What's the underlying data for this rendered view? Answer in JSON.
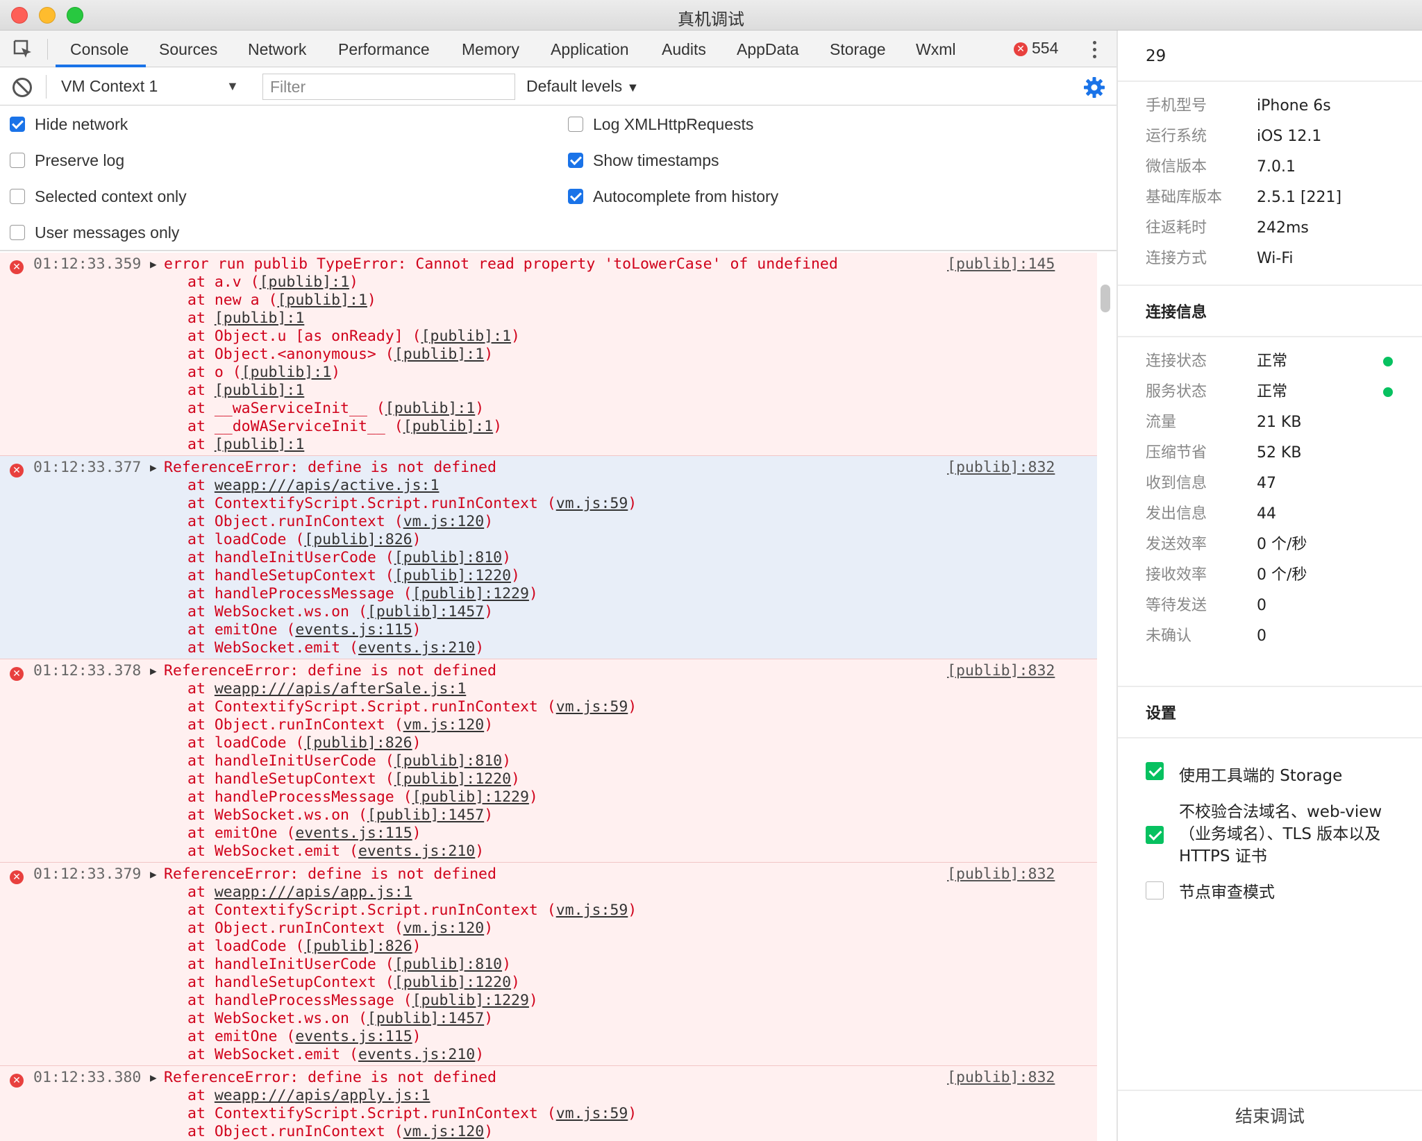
{
  "window": {
    "title": "真机调试"
  },
  "tabs": [
    "Console",
    "Sources",
    "Network",
    "Performance",
    "Memory",
    "Application",
    "Audits",
    "AppData",
    "Storage",
    "Wxml"
  ],
  "error_count": "554",
  "toolbar": {
    "context": "VM Context 1",
    "filter_placeholder": "Filter",
    "levels": "Default levels"
  },
  "settings": {
    "hide_network": {
      "label": "Hide network",
      "checked": true
    },
    "preserve_log": {
      "label": "Preserve log",
      "checked": false
    },
    "selected_context": {
      "label": "Selected context only",
      "checked": false
    },
    "user_messages": {
      "label": "User messages only",
      "checked": false
    },
    "log_xhr": {
      "label": "Log XMLHttpRequests",
      "checked": false
    },
    "show_timestamps": {
      "label": "Show timestamps",
      "checked": true
    },
    "autocomplete": {
      "label": "Autocomplete from history",
      "checked": true
    }
  },
  "messages": [
    {
      "time": "01:12:33.359",
      "text": "error run publib TypeError: Cannot read property 'toLowerCase' of undefined",
      "source": "[publib]:145",
      "highlight": "pink",
      "frames": [
        {
          "fn": "a.v",
          "loc": "[publib]:1",
          "wrap": true
        },
        {
          "fn": "new a",
          "loc": "[publib]:1",
          "wrap": true
        },
        {
          "fn": "",
          "loc": "[publib]:1",
          "wrap": false
        },
        {
          "fn": "Object.u [as onReady]",
          "loc": "[publib]:1",
          "wrap": true
        },
        {
          "fn": "Object.<anonymous>",
          "loc": "[publib]:1",
          "wrap": true
        },
        {
          "fn": "o",
          "loc": "[publib]:1",
          "wrap": true
        },
        {
          "fn": "",
          "loc": "[publib]:1",
          "wrap": false
        },
        {
          "fn": "__waServiceInit__",
          "loc": "[publib]:1",
          "wrap": true
        },
        {
          "fn": "__doWAServiceInit__",
          "loc": "[publib]:1",
          "wrap": true
        },
        {
          "fn": "",
          "loc": "[publib]:1",
          "wrap": false
        }
      ]
    },
    {
      "time": "01:12:33.377",
      "text": "ReferenceError: define is not defined",
      "source": "[publib]:832",
      "highlight": "blue",
      "frames": [
        {
          "fn": "",
          "loc": "weapp:///apis/active.js:1",
          "wrap": false
        },
        {
          "fn": "ContextifyScript.Script.runInContext",
          "loc": "vm.js:59",
          "wrap": true
        },
        {
          "fn": "Object.runInContext",
          "loc": "vm.js:120",
          "wrap": true
        },
        {
          "fn": "loadCode",
          "loc": "[publib]:826",
          "wrap": true
        },
        {
          "fn": "handleInitUserCode",
          "loc": "[publib]:810",
          "wrap": true
        },
        {
          "fn": "handleSetupContext",
          "loc": "[publib]:1220",
          "wrap": true
        },
        {
          "fn": "handleProcessMessage",
          "loc": "[publib]:1229",
          "wrap": true
        },
        {
          "fn": "WebSocket.ws.on",
          "loc": "[publib]:1457",
          "wrap": true
        },
        {
          "fn": "emitOne",
          "loc": "events.js:115",
          "wrap": true
        },
        {
          "fn": "WebSocket.emit",
          "loc": "events.js:210",
          "wrap": true
        }
      ]
    },
    {
      "time": "01:12:33.378",
      "text": "ReferenceError: define is not defined",
      "source": "[publib]:832",
      "highlight": "pink",
      "frames": [
        {
          "fn": "",
          "loc": "weapp:///apis/afterSale.js:1",
          "wrap": false
        },
        {
          "fn": "ContextifyScript.Script.runInContext",
          "loc": "vm.js:59",
          "wrap": true
        },
        {
          "fn": "Object.runInContext",
          "loc": "vm.js:120",
          "wrap": true
        },
        {
          "fn": "loadCode",
          "loc": "[publib]:826",
          "wrap": true
        },
        {
          "fn": "handleInitUserCode",
          "loc": "[publib]:810",
          "wrap": true
        },
        {
          "fn": "handleSetupContext",
          "loc": "[publib]:1220",
          "wrap": true
        },
        {
          "fn": "handleProcessMessage",
          "loc": "[publib]:1229",
          "wrap": true
        },
        {
          "fn": "WebSocket.ws.on",
          "loc": "[publib]:1457",
          "wrap": true
        },
        {
          "fn": "emitOne",
          "loc": "events.js:115",
          "wrap": true
        },
        {
          "fn": "WebSocket.emit",
          "loc": "events.js:210",
          "wrap": true
        }
      ]
    },
    {
      "time": "01:12:33.379",
      "text": "ReferenceError: define is not defined",
      "source": "[publib]:832",
      "highlight": "pink",
      "frames": [
        {
          "fn": "",
          "loc": "weapp:///apis/app.js:1",
          "wrap": false
        },
        {
          "fn": "ContextifyScript.Script.runInContext",
          "loc": "vm.js:59",
          "wrap": true
        },
        {
          "fn": "Object.runInContext",
          "loc": "vm.js:120",
          "wrap": true
        },
        {
          "fn": "loadCode",
          "loc": "[publib]:826",
          "wrap": true
        },
        {
          "fn": "handleInitUserCode",
          "loc": "[publib]:810",
          "wrap": true
        },
        {
          "fn": "handleSetupContext",
          "loc": "[publib]:1220",
          "wrap": true
        },
        {
          "fn": "handleProcessMessage",
          "loc": "[publib]:1229",
          "wrap": true
        },
        {
          "fn": "WebSocket.ws.on",
          "loc": "[publib]:1457",
          "wrap": true
        },
        {
          "fn": "emitOne",
          "loc": "events.js:115",
          "wrap": true
        },
        {
          "fn": "WebSocket.emit",
          "loc": "events.js:210",
          "wrap": true
        }
      ]
    },
    {
      "time": "01:12:33.380",
      "text": "ReferenceError: define is not defined",
      "source": "[publib]:832",
      "highlight": "pink",
      "frames": [
        {
          "fn": "",
          "loc": "weapp:///apis/apply.js:1",
          "wrap": false
        },
        {
          "fn": "ContextifyScript.Script.runInContext",
          "loc": "vm.js:59",
          "wrap": true
        },
        {
          "fn": "Object.runInContext",
          "loc": "vm.js:120",
          "wrap": true
        }
      ]
    }
  ],
  "panel": {
    "number": "29",
    "device": [
      {
        "key": "手机型号",
        "value": "iPhone 6s"
      },
      {
        "key": "运行系统",
        "value": "iOS 12.1"
      },
      {
        "key": "微信版本",
        "value": "7.0.1"
      },
      {
        "key": "基础库版本",
        "value": "2.5.1 [221]"
      },
      {
        "key": "往返耗时",
        "value": "242ms"
      },
      {
        "key": "连接方式",
        "value": "Wi-Fi"
      }
    ],
    "connection_title": "连接信息",
    "connection": [
      {
        "key": "连接状态",
        "value": "正常",
        "dot": true
      },
      {
        "key": "服务状态",
        "value": "正常",
        "dot": true
      },
      {
        "key": "流量",
        "value": "21 KB"
      },
      {
        "key": "压缩节省",
        "value": "52 KB"
      },
      {
        "key": "收到信息",
        "value": "47"
      },
      {
        "key": "发出信息",
        "value": "44"
      },
      {
        "key": "发送效率",
        "value": "0 个/秒"
      },
      {
        "key": "接收效率",
        "value": "0 个/秒"
      },
      {
        "key": "等待发送",
        "value": "0"
      },
      {
        "key": "未确认",
        "value": "0"
      }
    ],
    "settings_title": "设置",
    "options": [
      {
        "label": "使用工具端的 Storage",
        "checked": true
      },
      {
        "label": "不校验合法域名、web-view（业务域名）、TLS 版本以及 HTTPS 证书",
        "checked": true
      },
      {
        "label": "节点审查模式",
        "checked": false
      }
    ],
    "end_button": "结束调试"
  },
  "colors": {
    "accent": "#1a73e8",
    "error": "#d0021b",
    "ok": "#07c160"
  }
}
